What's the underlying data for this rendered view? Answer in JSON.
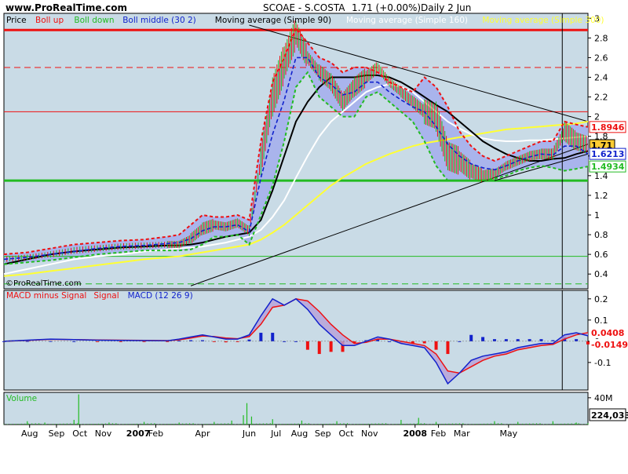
{
  "header": {
    "site": "www.ProRealTime.com",
    "symbol": "SCOAE - S.COSTA",
    "quote": "1.71 (+0.00%)",
    "period": "Daily  2 Jun"
  },
  "watermark": "©ProRealTime.com",
  "colors": {
    "panel_bg": "#c9dbe6",
    "band_fill": "#a9b4ec",
    "boll_up": "#ee1111",
    "boll_down": "#22bb22",
    "boll_mid": "#1122cc",
    "ma90": "#000000",
    "ma160": "#ffffff",
    "ma300": "#ffff33",
    "hline_red": "#ee1111",
    "hline_green": "#22bb22",
    "macd_signal": "#ee1111",
    "macd_line": "#1122cc",
    "hist_pos": "#1122cc",
    "hist_neg": "#ee1111",
    "volume": "#22bb22"
  },
  "chart_data": [
    {
      "type": "line",
      "panel": "price",
      "legend": [
        {
          "key": "price",
          "label": "Price",
          "color": "#000000"
        },
        {
          "key": "up",
          "label": "Boll up",
          "color": "#ee1111"
        },
        {
          "key": "down",
          "label": "Boll down",
          "color": "#22bb22"
        },
        {
          "key": "mid",
          "label": "Boll middle (30 2)",
          "color": "#1122cc"
        },
        {
          "key": "ma90",
          "label": "Moving average (Simple 90)",
          "color": "#000000"
        },
        {
          "key": "ma160",
          "label": "Moving average (Simple 160)",
          "color": "#ffffff"
        },
        {
          "key": "ma300",
          "label": "Moving average (Simple 300)",
          "color": "#ffff33"
        }
      ],
      "ylim": [
        0.25,
        3.05
      ],
      "yticks": [
        0.4,
        0.6,
        0.8,
        1,
        1.2,
        1.4,
        1.6,
        1.8,
        2,
        2.2,
        2.4,
        2.6,
        2.8,
        3
      ],
      "ytick_labels": [
        "0.4",
        "0.6",
        "0.8",
        "1",
        "1.2",
        "1.4",
        "1.6",
        "1.8",
        "2",
        "2.2",
        "2.4",
        "2.6",
        "2.8",
        "3"
      ],
      "x": [
        0,
        20,
        40,
        60,
        80,
        100,
        120,
        140,
        150,
        160,
        170,
        180,
        190,
        200,
        210,
        220,
        230,
        240,
        250,
        260,
        270,
        280,
        290,
        300,
        310,
        320,
        330,
        340,
        350,
        360,
        370,
        380,
        390,
        400,
        410,
        420,
        430,
        440,
        450,
        460,
        470,
        480,
        490,
        500
      ],
      "x_range": [
        0,
        500
      ],
      "series": [
        {
          "key": "price",
          "values": [
            0.55,
            0.57,
            0.6,
            0.64,
            0.66,
            0.68,
            0.69,
            0.7,
            0.7,
            0.76,
            0.86,
            0.9,
            0.88,
            0.92,
            0.84,
            1.55,
            2.2,
            2.55,
            2.85,
            2.6,
            2.45,
            2.35,
            2.15,
            2.3,
            2.4,
            2.5,
            2.35,
            2.25,
            2.15,
            2.05,
            2.0,
            1.6,
            1.55,
            1.45,
            1.4,
            1.42,
            1.5,
            1.55,
            1.6,
            1.62,
            1.62,
            1.85,
            1.75,
            1.71
          ]
        },
        {
          "key": "up",
          "values": [
            0.6,
            0.62,
            0.66,
            0.7,
            0.72,
            0.74,
            0.75,
            0.78,
            0.8,
            0.9,
            1.0,
            0.98,
            0.98,
            1.0,
            0.95,
            1.75,
            2.35,
            2.6,
            2.9,
            2.75,
            2.6,
            2.55,
            2.45,
            2.5,
            2.5,
            2.45,
            2.35,
            2.3,
            2.25,
            2.4,
            2.3,
            2.1,
            1.85,
            1.7,
            1.6,
            1.55,
            1.6,
            1.65,
            1.7,
            1.75,
            1.75,
            1.95,
            1.92,
            1.8946
          ]
        },
        {
          "key": "down",
          "values": [
            0.5,
            0.52,
            0.54,
            0.57,
            0.6,
            0.62,
            0.64,
            0.64,
            0.64,
            0.65,
            0.7,
            0.78,
            0.78,
            0.8,
            0.7,
            1.0,
            1.3,
            1.75,
            2.3,
            2.45,
            2.2,
            2.1,
            2.0,
            2.0,
            2.2,
            2.25,
            2.15,
            2.05,
            1.95,
            1.75,
            1.5,
            1.35,
            1.35,
            1.35,
            1.35,
            1.37,
            1.4,
            1.45,
            1.48,
            1.5,
            1.48,
            1.45,
            1.47,
            1.4934
          ]
        },
        {
          "key": "mid",
          "values": [
            0.55,
            0.57,
            0.6,
            0.63,
            0.66,
            0.68,
            0.69,
            0.71,
            0.72,
            0.76,
            0.84,
            0.88,
            0.88,
            0.9,
            0.83,
            1.38,
            1.82,
            2.17,
            2.6,
            2.6,
            2.4,
            2.33,
            2.22,
            2.25,
            2.35,
            2.35,
            2.25,
            2.17,
            2.1,
            2.05,
            1.9,
            1.72,
            1.6,
            1.52,
            1.48,
            1.46,
            1.5,
            1.55,
            1.59,
            1.62,
            1.61,
            1.7,
            1.7,
            1.6213
          ]
        },
        {
          "key": "ma90",
          "values": [
            0.5,
            0.55,
            0.6,
            0.63,
            0.65,
            0.67,
            0.68,
            0.69,
            0.69,
            0.7,
            0.72,
            0.75,
            0.78,
            0.8,
            0.82,
            0.95,
            1.25,
            1.6,
            1.95,
            2.15,
            2.3,
            2.4,
            2.4,
            2.4,
            2.42,
            2.42,
            2.4,
            2.35,
            2.28,
            2.2,
            2.12,
            2.05,
            1.95,
            1.85,
            1.75,
            1.68,
            1.62,
            1.58,
            1.55,
            1.55,
            1.57,
            1.58,
            1.62,
            1.65
          ]
        },
        {
          "key": "ma160",
          "values": [
            0.4,
            0.45,
            0.5,
            0.55,
            0.58,
            0.6,
            0.63,
            0.65,
            0.66,
            0.67,
            0.68,
            0.7,
            0.72,
            0.75,
            0.78,
            0.85,
            0.98,
            1.15,
            1.38,
            1.6,
            1.8,
            1.95,
            2.05,
            2.15,
            2.25,
            2.3,
            2.33,
            2.3,
            2.25,
            2.15,
            2.05,
            1.95,
            1.88,
            1.82,
            1.78,
            1.76,
            1.75,
            1.75,
            1.76,
            1.76,
            1.77,
            1.78,
            1.79,
            1.8
          ]
        },
        {
          "key": "ma300",
          "values": [
            0.38,
            0.4,
            0.43,
            0.46,
            0.49,
            0.52,
            0.55,
            0.57,
            0.58,
            0.6,
            0.62,
            0.64,
            0.66,
            0.68,
            0.7,
            0.75,
            0.82,
            0.9,
            1.0,
            1.1,
            1.2,
            1.3,
            1.38,
            1.45,
            1.52,
            1.57,
            1.62,
            1.66,
            1.7,
            1.73,
            1.75,
            1.77,
            1.79,
            1.81,
            1.83,
            1.85,
            1.87,
            1.88,
            1.89,
            1.9,
            1.91,
            1.92,
            1.93,
            1.95
          ]
        }
      ],
      "hlines": [
        {
          "y": 2.88,
          "style": "solid",
          "color": "#ee1111",
          "width": 3
        },
        {
          "y": 2.5,
          "style": "dashed",
          "color": "#ee1111",
          "width": 1
        },
        {
          "y": 2.05,
          "style": "solid",
          "color": "#ee1111",
          "width": 1
        },
        {
          "y": 1.35,
          "style": "solid",
          "color": "#22bb22",
          "width": 3
        },
        {
          "y": 0.58,
          "style": "solid",
          "color": "#22bb22",
          "width": 1
        },
        {
          "y": 0.3,
          "style": "dashed",
          "color": "#22bb22",
          "width": 1
        }
      ],
      "trendlines": [
        {
          "x1": 160,
          "y1": 0.28,
          "x2": 500,
          "y2": 1.72
        },
        {
          "x1": 210,
          "y1": 2.93,
          "x2": 500,
          "y2": 1.95
        },
        {
          "x1": 420,
          "y1": 1.35,
          "x2": 500,
          "y2": 1.62
        }
      ],
      "vline_x": 478,
      "value_labels": [
        {
          "text": "1.8946",
          "y": 1.8946,
          "color": "#ee1111",
          "bg": "#ffffff"
        },
        {
          "text": "1.71",
          "y": 1.71,
          "color": "#000000",
          "bg": "#ffcc33"
        },
        {
          "text": "1.6213",
          "y": 1.6213,
          "color": "#1122cc",
          "bg": "#ffffff"
        },
        {
          "text": "1.4934",
          "y": 1.4934,
          "color": "#22bb22",
          "bg": "#ffffff"
        }
      ]
    },
    {
      "type": "line",
      "panel": "macd",
      "legend": [
        {
          "label": "MACD minus Signal",
          "color": "#ee1111"
        },
        {
          "label": "Signal",
          "color": "#ee1111"
        },
        {
          "label": "MACD (12 26 9)",
          "color": "#1122cc"
        }
      ],
      "ylim": [
        -0.23,
        0.24
      ],
      "yticks": [
        0.2,
        0.1,
        0,
        -0.1
      ],
      "ytick_labels": [
        "0.2",
        "0.1",
        "0",
        "-0.1"
      ],
      "x": [
        0,
        20,
        40,
        60,
        80,
        100,
        120,
        140,
        150,
        160,
        170,
        180,
        190,
        200,
        210,
        220,
        230,
        240,
        250,
        260,
        270,
        280,
        290,
        300,
        310,
        320,
        330,
        340,
        350,
        360,
        370,
        380,
        390,
        400,
        410,
        420,
        430,
        440,
        450,
        460,
        470,
        480,
        490,
        500
      ],
      "series": [
        {
          "name": "MACD",
          "values": [
            0,
            0.005,
            0.01,
            0.008,
            0.005,
            0.004,
            0.003,
            0.002,
            0.01,
            0.02,
            0.03,
            0.02,
            0.01,
            0.01,
            0.03,
            0.12,
            0.2,
            0.17,
            0.2,
            0.15,
            0.08,
            0.03,
            -0.02,
            -0.02,
            0,
            0.02,
            0.01,
            -0.01,
            -0.02,
            -0.03,
            -0.1,
            -0.2,
            -0.15,
            -0.09,
            -0.07,
            -0.06,
            -0.05,
            -0.03,
            -0.02,
            -0.01,
            -0.01,
            0.03,
            0.04,
            0.0259
          ]
        },
        {
          "name": "Signal",
          "values": [
            0,
            0.004,
            0.009,
            0.008,
            0.006,
            0.005,
            0.004,
            0.003,
            0.007,
            0.015,
            0.025,
            0.022,
            0.015,
            0.012,
            0.022,
            0.08,
            0.16,
            0.17,
            0.2,
            0.19,
            0.14,
            0.08,
            0.03,
            -0.01,
            -0.005,
            0.01,
            0.01,
            0.0,
            -0.01,
            -0.02,
            -0.06,
            -0.14,
            -0.15,
            -0.12,
            -0.09,
            -0.07,
            -0.06,
            -0.04,
            -0.03,
            -0.02,
            -0.015,
            0.01,
            0.03,
            0.0408
          ]
        }
      ],
      "histogram": [
        0,
        0.001,
        0.001,
        0,
        -0.001,
        -0.001,
        -0.001,
        -0.001,
        0.003,
        0.005,
        0.005,
        -0.002,
        -0.005,
        -0.002,
        0.008,
        0.04,
        0.04,
        0.0,
        0.0,
        -0.04,
        -0.06,
        -0.05,
        -0.05,
        -0.01,
        0.005,
        0.01,
        0.0,
        -0.01,
        -0.01,
        -0.01,
        -0.04,
        -0.06,
        0.0,
        0.03,
        0.02,
        0.01,
        0.01,
        0.01,
        0.01,
        0.01,
        0.005,
        0.02,
        0.01,
        -0.0149
      ],
      "value_labels": [
        {
          "text": "0.0408",
          "y": 0.0408,
          "color": "#ee1111",
          "bg": "#ffffff"
        },
        {
          "text": "-0.0149",
          "y": -0.0149,
          "color": "#ee1111",
          "bg": "#ffffff"
        }
      ]
    },
    {
      "type": "bar",
      "panel": "volume",
      "legend": [
        {
          "label": "Volume",
          "color": "#22bb22"
        }
      ],
      "ylim": [
        0,
        48
      ],
      "yticks": [
        40
      ],
      "ytick_labels": [
        "40M"
      ],
      "spikes": [
        {
          "x": 20,
          "v": 5
        },
        {
          "x": 35,
          "v": 3
        },
        {
          "x": 60,
          "v": 7
        },
        {
          "x": 64,
          "v": 45
        },
        {
          "x": 90,
          "v": 3
        },
        {
          "x": 120,
          "v": 4
        },
        {
          "x": 150,
          "v": 3
        },
        {
          "x": 180,
          "v": 4
        },
        {
          "x": 195,
          "v": 6
        },
        {
          "x": 205,
          "v": 14
        },
        {
          "x": 208,
          "v": 32
        },
        {
          "x": 212,
          "v": 12
        },
        {
          "x": 230,
          "v": 8
        },
        {
          "x": 255,
          "v": 6
        },
        {
          "x": 285,
          "v": 5
        },
        {
          "x": 340,
          "v": 7
        },
        {
          "x": 355,
          "v": 10
        },
        {
          "x": 370,
          "v": 4
        },
        {
          "x": 420,
          "v": 5
        },
        {
          "x": 440,
          "v": 4
        },
        {
          "x": 470,
          "v": 5
        },
        {
          "x": 490,
          "v": 3
        },
        {
          "x": 500,
          "v": 2
        }
      ],
      "value_labels": [
        {
          "text": "224,033",
          "color": "#000000",
          "bg": "#ffffff"
        }
      ]
    }
  ],
  "x_axis": {
    "labels": [
      {
        "x": 22,
        "text": "Aug"
      },
      {
        "x": 45,
        "text": "Sep"
      },
      {
        "x": 65,
        "text": "Oct"
      },
      {
        "x": 85,
        "text": "Nov"
      },
      {
        "x": 115,
        "text": "2007"
      },
      {
        "x": 130,
        "text": "Feb"
      },
      {
        "x": 170,
        "text": "Apr"
      },
      {
        "x": 210,
        "text": "Jun"
      },
      {
        "x": 233,
        "text": "Jul"
      },
      {
        "x": 253,
        "text": "Aug"
      },
      {
        "x": 273,
        "text": "Sep"
      },
      {
        "x": 293,
        "text": "Oct"
      },
      {
        "x": 313,
        "text": "Nov"
      },
      {
        "x": 352,
        "text": "2008"
      },
      {
        "x": 372,
        "text": "Feb"
      },
      {
        "x": 392,
        "text": "Mar"
      },
      {
        "x": 432,
        "text": "May"
      }
    ]
  }
}
